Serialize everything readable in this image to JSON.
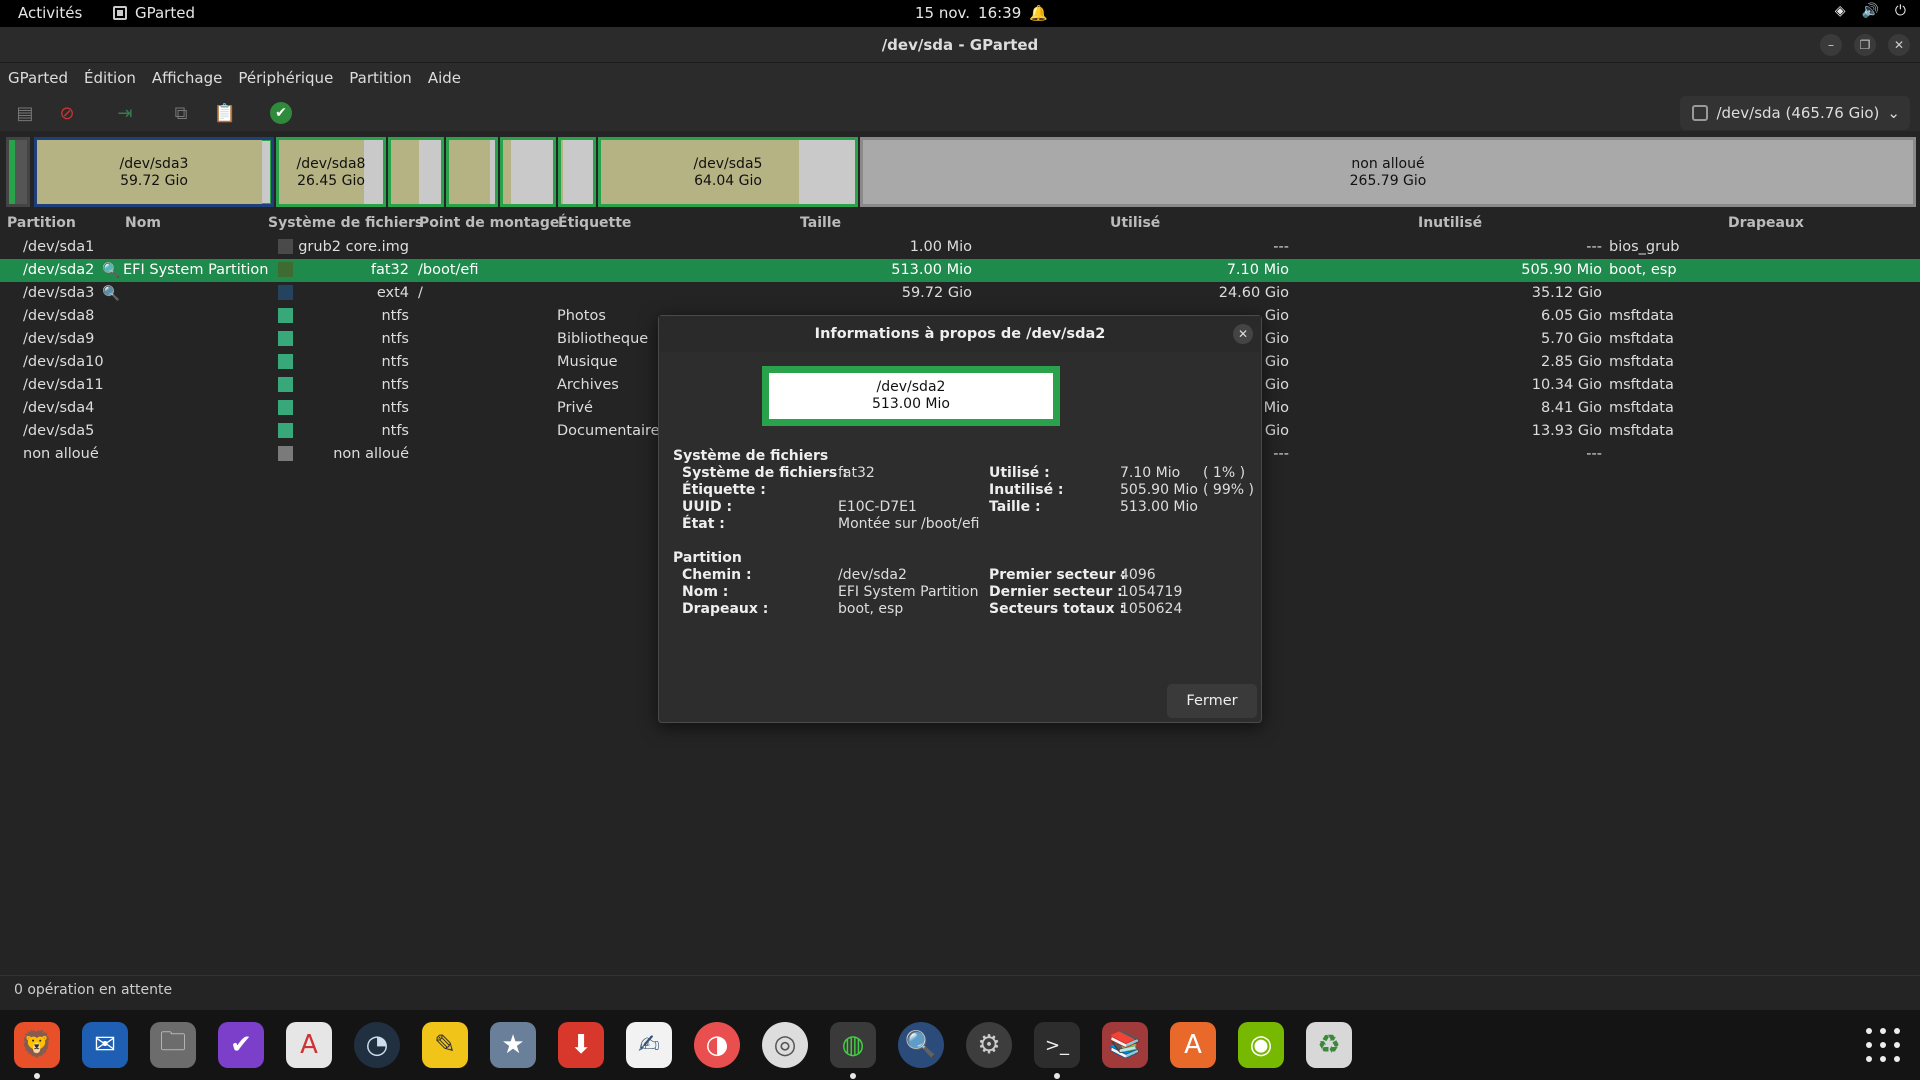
{
  "topbar": {
    "activities": "Activités",
    "app_name": "GParted",
    "date": "15 nov.",
    "time": "16:39"
  },
  "window": {
    "title": "/dev/sda - GParted"
  },
  "menu": [
    "GParted",
    "Édition",
    "Affichage",
    "Périphérique",
    "Partition",
    "Aide"
  ],
  "device_selector": "/dev/sda (465.76 Gio)",
  "partition_map": {
    "sda3": {
      "name": "/dev/sda3",
      "size": "59.72 Gio"
    },
    "sda8": {
      "name": "/dev/sda8",
      "size": "26.45 Gio"
    },
    "sda5": {
      "name": "/dev/sda5",
      "size": "64.04 Gio"
    },
    "unallocated": {
      "name": "non alloué",
      "size": "265.79 Gio"
    }
  },
  "columns": {
    "partition": "Partition",
    "name": "Nom",
    "fs": "Système de fichiers",
    "mount": "Point de montage",
    "label": "Étiquette",
    "size": "Taille",
    "used": "Utilisé",
    "unused": "Inutilisé",
    "flags": "Drapeaux"
  },
  "rows": [
    {
      "partition": "/dev/sda1",
      "name": "",
      "fs": "grub2 core.img",
      "mount": "",
      "label": "",
      "size": "1.00 Mio",
      "used": "---",
      "unused": "---",
      "flags": "bios_grub",
      "color": "#4a4a4a"
    },
    {
      "partition": "/dev/sda2",
      "name": "EFI System Partition",
      "fs": "fat32",
      "mount": "/boot/efi",
      "label": "",
      "size": "513.00 Mio",
      "used": "7.10 Mio",
      "unused": "505.90 Mio",
      "flags": "boot, esp",
      "color": "#3d6b31"
    },
    {
      "partition": "/dev/sda3",
      "name": "",
      "fs": "ext4",
      "mount": "/",
      "label": "",
      "size": "59.72 Gio",
      "used": "24.60 Gio",
      "unused": "35.12 Gio",
      "flags": "",
      "color": "#25435e"
    },
    {
      "partition": "/dev/sda8",
      "name": "",
      "fs": "ntfs",
      "mount": "",
      "label": "Photos",
      "size": "",
      "used": "Gio",
      "unused": "6.05 Gio",
      "flags": "msftdata",
      "color": "#38a87a"
    },
    {
      "partition": "/dev/sda9",
      "name": "",
      "fs": "ntfs",
      "mount": "",
      "label": "Bibliotheque",
      "size": "",
      "used": "Gio",
      "unused": "5.70 Gio",
      "flags": "msftdata",
      "color": "#38a87a"
    },
    {
      "partition": "/dev/sda10",
      "name": "",
      "fs": "ntfs",
      "mount": "",
      "label": "Musique",
      "size": "",
      "used": "Gio",
      "unused": "2.85 Gio",
      "flags": "msftdata",
      "color": "#38a87a"
    },
    {
      "partition": "/dev/sda11",
      "name": "",
      "fs": "ntfs",
      "mount": "",
      "label": "Archives",
      "size": "",
      "used": "Gio",
      "unused": "10.34 Gio",
      "flags": "msftdata",
      "color": "#38a87a"
    },
    {
      "partition": "/dev/sda4",
      "name": "",
      "fs": "ntfs",
      "mount": "",
      "label": "Privé",
      "size": "",
      "used": "Mio",
      "unused": "8.41 Gio",
      "flags": "msftdata",
      "color": "#38a87a"
    },
    {
      "partition": "/dev/sda5",
      "name": "",
      "fs": "ntfs",
      "mount": "",
      "label": "Documentaires",
      "size": "",
      "used": "Gio",
      "unused": "13.93 Gio",
      "flags": "msftdata",
      "color": "#38a87a"
    },
    {
      "partition": "non alloué",
      "name": "",
      "fs": "non alloué",
      "mount": "",
      "label": "",
      "size": "",
      "used": "---",
      "unused": "---",
      "flags": "",
      "color": "#7a7a7a"
    }
  ],
  "status": "0 opération en attente",
  "dialog": {
    "title": "Informations à propos de /dev/sda2",
    "preview_name": "/dev/sda2",
    "preview_size": "513.00 Mio",
    "fs_section": "Système de fichiers",
    "fs_label": "Système de fichiers :",
    "fs_value": "fat32",
    "etiquette_label": "Étiquette :",
    "uuid_label": "UUID :",
    "uuid_value": "E10C-D7E1",
    "etat_label": "État :",
    "etat_value": "Montée sur /boot/efi",
    "used_label": "Utilisé :",
    "used_value": "7.10 Mio",
    "used_pct": "( 1% )",
    "unused_label": "Inutilisé :",
    "unused_value": "505.90 Mio",
    "unused_pct": "( 99% )",
    "size_label": "Taille :",
    "size_value": "513.00 Mio",
    "part_section": "Partition",
    "path_label": "Chemin :",
    "path_value": "/dev/sda2",
    "name_label": "Nom :",
    "name_value": "EFI System Partition",
    "flags_label": "Drapeaux :",
    "flags_value": "boot, esp",
    "first_sector_label": "Premier secteur :",
    "first_sector_value": "4096",
    "last_sector_label": "Dernier secteur :",
    "last_sector_value": "1054719",
    "total_sectors_label": "Secteurs totaux :",
    "total_sectors_value": "1050624",
    "close_button": "Fermer"
  }
}
